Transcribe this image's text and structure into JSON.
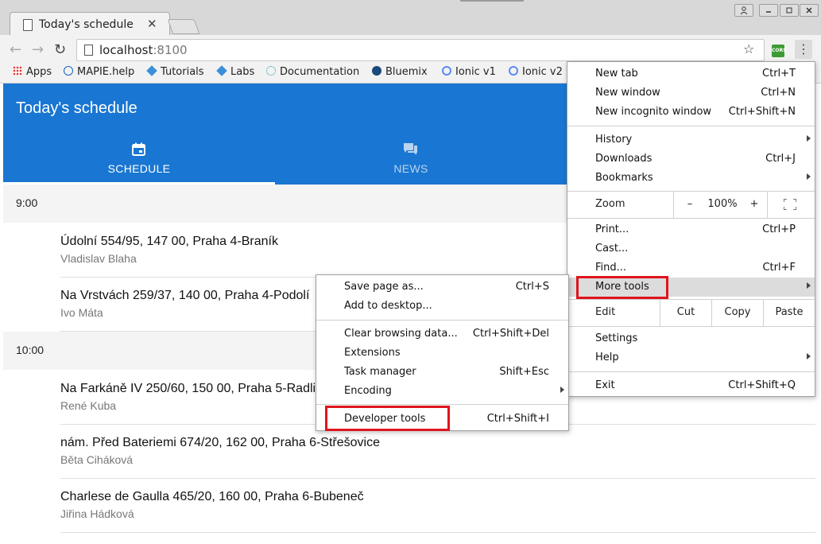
{
  "window": {
    "tab_title": "Today's schedule",
    "controls": {
      "user": "user-icon",
      "minimize": "minimize-icon",
      "maximize": "maximize-icon",
      "close": "close-icon"
    }
  },
  "toolbar": {
    "back": "←",
    "forward": "→",
    "reload": "↻",
    "url_host": "localhost",
    "url_port": ":8100",
    "cors_label": "CORS"
  },
  "bookmarks": [
    {
      "label": "Apps",
      "icon": "apps-grid-icon"
    },
    {
      "label": "MAPIE.help",
      "icon": "mapie-icon"
    },
    {
      "label": "Tutorials",
      "icon": "tutorials-icon"
    },
    {
      "label": "Labs",
      "icon": "labs-icon"
    },
    {
      "label": "Documentation",
      "icon": "documentation-icon"
    },
    {
      "label": "Bluemix",
      "icon": "bluemix-icon"
    },
    {
      "label": "Ionic v1",
      "icon": "ionic-icon"
    },
    {
      "label": "Ionic v2",
      "icon": "ionic-icon"
    }
  ],
  "app": {
    "title": "Today's schedule",
    "tabs": [
      {
        "label": "SCHEDULE",
        "icon": "calendar-icon",
        "active": true
      },
      {
        "label": "NEWS",
        "icon": "chat-icon",
        "active": false
      }
    ],
    "groups": [
      {
        "time": "9:00",
        "items": [
          {
            "address": "Údolní 554/95, 147 00, Praha 4-Braník",
            "name": "Vladislav Blaha"
          },
          {
            "address": "Na Vrstvách 259/37, 140 00, Praha 4-Podolí",
            "name": "Ivo Máta"
          }
        ]
      },
      {
        "time": "10:00",
        "items": [
          {
            "address": "Na Farkáně IV 250/60, 150 00, Praha 5-Radlice",
            "name": "René Kuba"
          },
          {
            "address": "nám. Před Bateriemi 674/20, 162 00, Praha 6-Střešovice",
            "name": "Běta Ciháková"
          },
          {
            "address": "Charlese de Gaulla 465/20, 160 00, Praha 6-Bubeneč",
            "name": "Jiřina Hádková"
          }
        ]
      }
    ]
  },
  "main_menu": {
    "new_tab": {
      "label": "New tab",
      "shortcut": "Ctrl+T"
    },
    "new_window": {
      "label": "New window",
      "shortcut": "Ctrl+N"
    },
    "new_incognito": {
      "label": "New incognito window",
      "shortcut": "Ctrl+Shift+N"
    },
    "history": {
      "label": "History"
    },
    "downloads": {
      "label": "Downloads",
      "shortcut": "Ctrl+J"
    },
    "bookmarks": {
      "label": "Bookmarks"
    },
    "zoom": {
      "label": "Zoom",
      "minus": "–",
      "value": "100%",
      "plus": "+"
    },
    "print": {
      "label": "Print...",
      "shortcut": "Ctrl+P"
    },
    "cast": {
      "label": "Cast..."
    },
    "find": {
      "label": "Find...",
      "shortcut": "Ctrl+F"
    },
    "more_tools": {
      "label": "More tools"
    },
    "edit": {
      "label": "Edit",
      "cut": "Cut",
      "copy": "Copy",
      "paste": "Paste"
    },
    "settings": {
      "label": "Settings"
    },
    "help": {
      "label": "Help"
    },
    "exit": {
      "label": "Exit",
      "shortcut": "Ctrl+Shift+Q"
    }
  },
  "more_tools_menu": {
    "save_page": {
      "label": "Save page as...",
      "shortcut": "Ctrl+S"
    },
    "add_desktop": {
      "label": "Add to desktop..."
    },
    "clear_data": {
      "label": "Clear browsing data...",
      "shortcut": "Ctrl+Shift+Del"
    },
    "extensions": {
      "label": "Extensions"
    },
    "task_manager": {
      "label": "Task manager",
      "shortcut": "Shift+Esc"
    },
    "encoding": {
      "label": "Encoding"
    },
    "dev_tools": {
      "label": "Developer tools",
      "shortcut": "Ctrl+Shift+I"
    }
  },
  "colors": {
    "header": "#1976d2",
    "highlight": "#e0141d"
  }
}
